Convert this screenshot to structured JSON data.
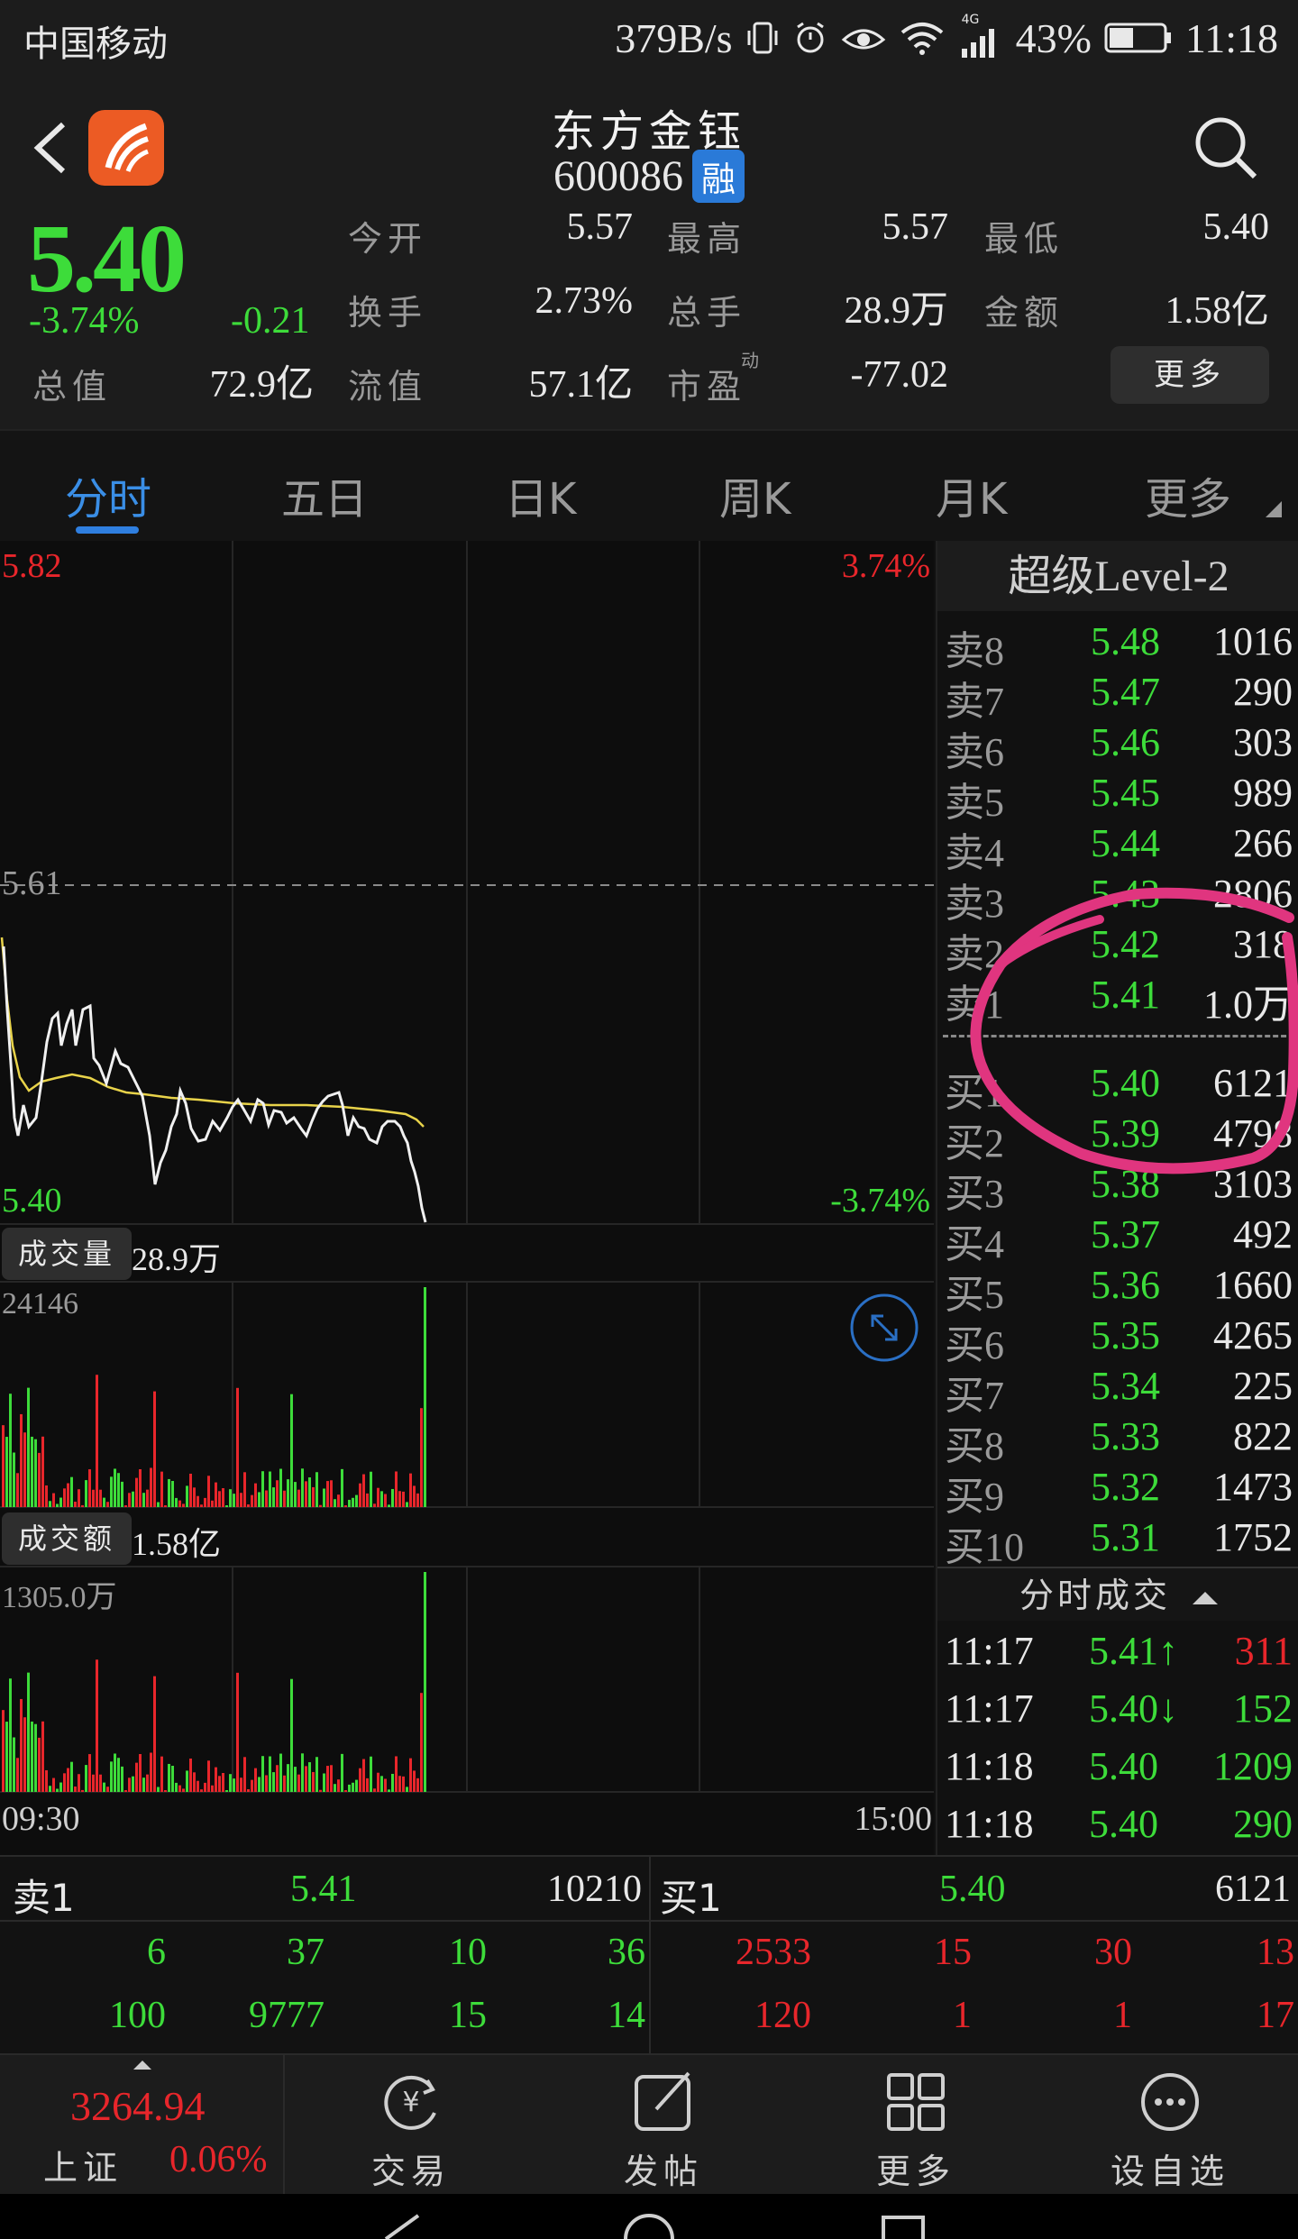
{
  "status_bar": {
    "carrier": "中国移动",
    "net_speed": "379B/s",
    "network": "4G",
    "battery": "43%",
    "time": "11:18"
  },
  "header": {
    "stock_name": "东方金钰",
    "stock_code": "600086",
    "badge": "融",
    "price": "5.40",
    "pct_change": "-3.74%",
    "amt_change": "-0.21",
    "stats": {
      "open_label": "今开",
      "open_value": "5.57",
      "high_label": "最高",
      "high_value": "5.57",
      "low_label": "最低",
      "low_value": "5.40",
      "turnover_label": "换手",
      "turnover_value": "2.73%",
      "volume_label": "总手",
      "volume_value": "28.9万",
      "amount_label": "金额",
      "amount_value": "1.58亿",
      "mktcap_label": "总值",
      "mktcap_value": "72.9亿",
      "float_label": "流值",
      "float_value": "57.1亿",
      "pe_label": "市盈",
      "pe_sup": "动",
      "pe_value": "-77.02"
    },
    "more_button": "更多"
  },
  "tabs": [
    "分时",
    "五日",
    "日K",
    "周K",
    "月K",
    "更多"
  ],
  "chart": {
    "price_high": "5.82",
    "price_high_pct": "3.74%",
    "price_mid": "5.61",
    "price_low": "5.40",
    "price_low_pct": "-3.74%",
    "volume_tag": "成交量",
    "volume_value": "28.9万",
    "volume_max": "24146",
    "amount_tag": "成交额",
    "amount_value": "1.58亿",
    "amount_max": "1305.0万",
    "time_start": "09:30",
    "time_end": "15:00"
  },
  "level2": {
    "title": "超级Level-2",
    "asks": [
      {
        "label": "卖8",
        "price": "5.48",
        "vol": "1016"
      },
      {
        "label": "卖7",
        "price": "5.47",
        "vol": "290"
      },
      {
        "label": "卖6",
        "price": "5.46",
        "vol": "303"
      },
      {
        "label": "卖5",
        "price": "5.45",
        "vol": "989"
      },
      {
        "label": "卖4",
        "price": "5.44",
        "vol": "266"
      },
      {
        "label": "卖3",
        "price": "5.43",
        "vol": "2806"
      },
      {
        "label": "卖2",
        "price": "5.42",
        "vol": "318"
      },
      {
        "label": "卖1",
        "price": "5.41",
        "vol": "1.0万"
      }
    ],
    "bids": [
      {
        "label": "买1",
        "price": "5.40",
        "vol": "6121"
      },
      {
        "label": "买2",
        "price": "5.39",
        "vol": "4798"
      },
      {
        "label": "买3",
        "price": "5.38",
        "vol": "3103"
      },
      {
        "label": "买4",
        "price": "5.37",
        "vol": "492"
      },
      {
        "label": "买5",
        "price": "5.36",
        "vol": "1660"
      },
      {
        "label": "买6",
        "price": "5.35",
        "vol": "4265"
      },
      {
        "label": "买7",
        "price": "5.34",
        "vol": "225"
      },
      {
        "label": "买8",
        "price": "5.33",
        "vol": "822"
      },
      {
        "label": "买9",
        "price": "5.32",
        "vol": "1473"
      },
      {
        "label": "买10",
        "price": "5.31",
        "vol": "1752"
      }
    ],
    "ticks_title": "分时成交",
    "ticks": [
      {
        "time": "11:17",
        "price": "5.41↑",
        "vol": "311",
        "color": "#e8262b"
      },
      {
        "time": "11:17",
        "price": "5.40↓",
        "vol": "152",
        "color": "#3ddc3a"
      },
      {
        "time": "11:18",
        "price": "5.40",
        "vol": "1209",
        "color": "#3ddc3a"
      },
      {
        "time": "11:18",
        "price": "5.40",
        "vol": "290",
        "color": "#3ddc3a"
      }
    ]
  },
  "book": {
    "ask_label": "卖1",
    "ask_price": "5.41",
    "ask_vol": "10210",
    "bid_label": "买1",
    "bid_price": "5.40",
    "bid_vol": "6121",
    "sell_row1": [
      "6",
      "37",
      "10",
      "36"
    ],
    "sell_row2": [
      "100",
      "9777",
      "15",
      "14"
    ],
    "buy_row1": [
      "2533",
      "15",
      "30",
      "13"
    ],
    "buy_row2": [
      "120",
      "1",
      "1",
      "17"
    ]
  },
  "bottom_nav": {
    "index_value": "3264.94",
    "index_name": "上证",
    "index_pct": "0.06%",
    "items": [
      "交易",
      "发帖",
      "更多",
      "设自选"
    ]
  },
  "colors": {
    "up": "#e8262b",
    "down": "#3ddc3a",
    "accent": "#2f7fe0",
    "annotation": "#e0357f"
  }
}
